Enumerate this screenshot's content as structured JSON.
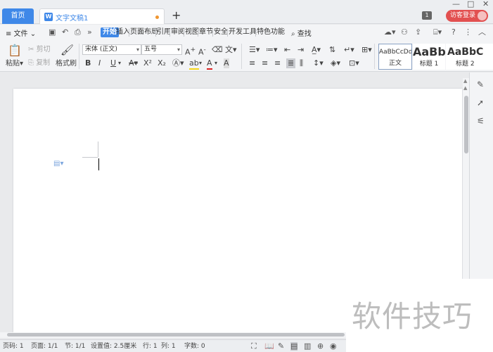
{
  "titlebar": {
    "home_tab": "首页",
    "doc_tab": "文字文稿1",
    "doc_icon": "W",
    "new_tab": "+",
    "badge": "1",
    "login": "访客登录",
    "min": "—",
    "max": "□",
    "close": "✕"
  },
  "menubar": {
    "file_menu": "≡ 文件 ⌄",
    "more": "»",
    "tabs": [
      "开始",
      "插入",
      "页面布局",
      "引用",
      "审阅",
      "视图",
      "章节",
      "安全",
      "开发工具",
      "特色功能"
    ],
    "search": "查找",
    "help": "?",
    "active_tab_color": "#3f88e8"
  },
  "ribbon": {
    "paste": "粘贴",
    "cut": "剪切",
    "copy": "复制",
    "format_painter": "格式刷",
    "font_name": "宋体 (正文)",
    "font_size": "五号",
    "bold": "B",
    "italic": "I",
    "underline": "U",
    "superscript": "X²",
    "subscript": "X₂",
    "font_color": "A",
    "styles": [
      {
        "preview": "AaBbCcDd",
        "label": "正文"
      },
      {
        "preview": "AaBb",
        "label": "标题 1"
      },
      {
        "preview": "AaBbC",
        "label": "标题 2"
      }
    ]
  },
  "statusbar": {
    "page_code": "页码: 1",
    "page": "页面: 1/1",
    "section": "节: 1/1",
    "setting": "设置值: 2.5厘米",
    "row": "行: 1",
    "col": "列: 1",
    "words": "字数: 0"
  },
  "watermark": "软件技巧"
}
